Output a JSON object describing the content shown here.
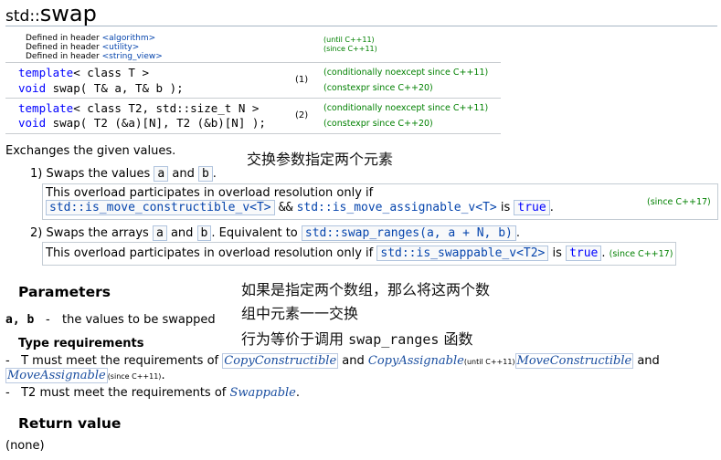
{
  "title": {
    "namespace": "std::",
    "name": "swap"
  },
  "headers": {
    "prefix": "Defined in header",
    "items": [
      {
        "header": "<algorithm>",
        "note": "(until C++11)"
      },
      {
        "header": "<utility>",
        "note": "(since C++11)"
      },
      {
        "header": "<string_view>",
        "note": ""
      }
    ]
  },
  "declarations": [
    {
      "line1_kw": "template",
      "line1_rest": "< class T >",
      "line2_kw": "void",
      "line2_rest": " swap( T& a, T& b );",
      "num": "(1)",
      "note1": "(conditionally noexcept since C++11)",
      "note2": "(constexpr since C++20)"
    },
    {
      "line1_kw": "template",
      "line1_rest": "< class T2, std::size_t N >",
      "line2_kw": "void",
      "line2_rest": " swap( T2 (&a)[N], T2 (&b)[N] );",
      "num": "(2)",
      "note1": "(conditionally noexcept since C++11)",
      "note2": "(constexpr since C++20)"
    }
  ],
  "description": "Exchanges the given values.",
  "annotations": {
    "a1": "交换参数指定两个元素",
    "a2_line1": "如果是指定两个数组，那么将这两个数",
    "a2_line2": "组中元素一一交换",
    "a3_prefix": "行为等价于调用",
    "a3_code": "swap_ranges",
    "a3_suffix": "函数"
  },
  "item1": {
    "num": "1)",
    "text1": "Swaps the values",
    "code_a": "a",
    "and": "and",
    "code_b": "b",
    "end": ".",
    "box_line1": "This overload participates in overload resolution only if",
    "box_code1": "std::is_move_constructible_v<T>",
    "box_and": "&&",
    "box_code2": "std::is_move_assignable_v<T>",
    "box_is": "is",
    "box_true": "true",
    "box_end": ".",
    "box_note": "(since C++17)"
  },
  "item2": {
    "num": "2)",
    "text1": "Swaps the arrays",
    "code_a": "a",
    "and": "and",
    "code_b": "b",
    "text2": ". Equivalent to",
    "code_sr": "std::swap_ranges(a, a + N, b)",
    "end": ".",
    "box_line": "This overload participates in overload resolution only if",
    "box_code": "std::is_swappable_v<T2>",
    "box_is": "is",
    "box_true": "true",
    "box_end": ".",
    "box_note": "(since C++17)"
  },
  "parameters": {
    "heading": "Parameters",
    "param_name": "a, b",
    "param_dash": "-",
    "param_desc": "the values to be swapped",
    "type_req_heading": "Type requirements",
    "req1_dash": "-",
    "req1_pre": "T must meet the requirements of",
    "req1_c1": "CopyConstructible",
    "req1_and1": "and",
    "req1_c2": "CopyAssignable",
    "req1_note": "(until C++11)",
    "req1_c3": "MoveConstructible",
    "req1_and2": "and",
    "req1_c4": "MoveAssignable",
    "req1_note2": "(since C++11)",
    "req1_end": ".",
    "req2_dash": "-",
    "req2_pre": "T2 must meet the requirements of",
    "req2_c1": "Swappable",
    "req2_end": "."
  },
  "return_value": {
    "heading": "Return value",
    "text": "(none)"
  }
}
